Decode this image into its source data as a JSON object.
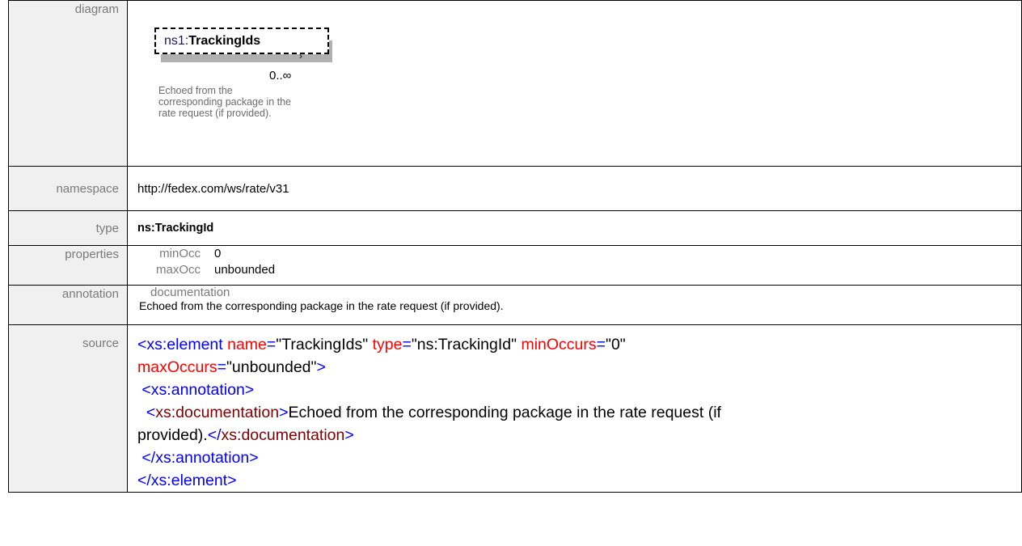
{
  "labels": {
    "diagram": "diagram",
    "namespace": "namespace",
    "type": "type",
    "properties": "properties",
    "annotation": "annotation",
    "source": "source"
  },
  "diagram": {
    "prefix": "ns1:",
    "name": "TrackingIds",
    "occurrence": "0..∞",
    "doc_lines": [
      "Echoed from the",
      "corresponding package in the",
      "rate request (if provided)."
    ]
  },
  "namespace": "http://fedex.com/ws/rate/v31",
  "type": "ns:TrackingId",
  "properties": [
    {
      "key": "minOcc",
      "value": "0"
    },
    {
      "key": "maxOcc",
      "value": "unbounded"
    }
  ],
  "annotation": {
    "heading": "documentation",
    "text": "Echoed from the corresponding  package in the rate request (if provided)."
  },
  "source": {
    "open_tag": "<xs:element",
    "attr_name": "name",
    "val_name": "\"TrackingIds\"",
    "attr_type": "type",
    "val_type": "\"ns:TrackingId\"",
    "attr_min": "minOccurs",
    "val_min": "\"0\"",
    "attr_max": "maxOccurs",
    "val_max": "\"unbounded\"",
    "close_bracket": ">",
    "ann_open": "<xs:annotation>",
    "doc_open_lt": "<",
    "doc_open_name": "xs:documentation",
    "doc_open_gt": ">",
    "doc_text_1": "Echoed from the corresponding package in the rate request (if",
    "doc_text_2": "provided).",
    "doc_close_lt": "</",
    "doc_close_name": "xs:documentation",
    "doc_close_gt": ">",
    "ann_close": "</xs:annotation>",
    "elem_close": "</xs:element>",
    "eq": "="
  },
  "colors": {
    "tag": "#0000ff",
    "element_name": "#800000",
    "attribute": "#ff0000",
    "label_bg": "#f0f0f0",
    "header_strip": "#3c2a8c"
  }
}
